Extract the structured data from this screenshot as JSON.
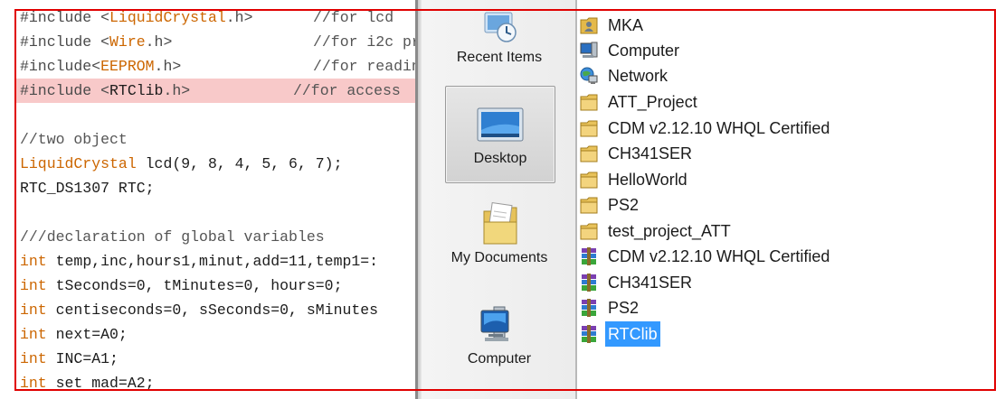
{
  "editor": {
    "lines": [
      {
        "type": "include",
        "prefix": "#include <",
        "lib": "LiquidCrystal",
        "suffix": ".h>",
        "comment": "//for lcd"
      },
      {
        "type": "include",
        "prefix": "#include <",
        "lib": "Wire",
        "suffix": ".h>",
        "comment": "//for i2c pr"
      },
      {
        "type": "include",
        "prefix": "#include<",
        "lib": "EEPROM",
        "suffix": ".h>",
        "comment": "//for reading"
      },
      {
        "type": "include",
        "prefix": "#include <",
        "lib": "RTClib",
        "suffix": ".h>",
        "comment": "//for access"
      },
      {
        "type": "blank"
      },
      {
        "type": "comment",
        "text": "//two object"
      },
      {
        "type": "decl",
        "kw": "LiquidCrystal",
        "rest": " lcd(9, 8, 4, 5, 6, 7);"
      },
      {
        "type": "plain",
        "text": "RTC_DS1307 RTC;"
      },
      {
        "type": "blank"
      },
      {
        "type": "comment",
        "text": "///declaration of global variables"
      },
      {
        "type": "decl",
        "kw": "int",
        "rest": " temp,inc,hours1,minut,add=11,temp1=:"
      },
      {
        "type": "decl",
        "kw": "int",
        "rest": " tSeconds=0, tMinutes=0, hours=0;"
      },
      {
        "type": "decl",
        "kw": "int",
        "rest": " centiseconds=0, sSeconds=0, sMinutes"
      },
      {
        "type": "decl",
        "kw": "int",
        "rest": " next=A0;"
      },
      {
        "type": "decl",
        "kw": "int",
        "rest": " INC=A1;"
      },
      {
        "type": "decl",
        "kw": "int",
        "rest": " set mad=A2;"
      }
    ]
  },
  "places": {
    "items": [
      {
        "label": "Recent Items",
        "icon": "recent-items-icon"
      },
      {
        "label": "Desktop",
        "icon": "desktop-icon",
        "selected": true
      },
      {
        "label": "My Documents",
        "icon": "my-documents-icon"
      },
      {
        "label": "Computer",
        "icon": "computer-icon"
      }
    ]
  },
  "files": {
    "items": [
      {
        "name": "MKA",
        "icon": "user-folder-icon"
      },
      {
        "name": "Computer",
        "icon": "computer-icon"
      },
      {
        "name": "Network",
        "icon": "network-icon"
      },
      {
        "name": "ATT_Project",
        "icon": "folder-icon"
      },
      {
        "name": "CDM v2.12.10 WHQL Certified",
        "icon": "folder-icon"
      },
      {
        "name": "CH341SER",
        "icon": "folder-icon"
      },
      {
        "name": "HelloWorld",
        "icon": "folder-icon"
      },
      {
        "name": "PS2",
        "icon": "folder-icon"
      },
      {
        "name": "test_project_ATT",
        "icon": "folder-icon"
      },
      {
        "name": "CDM v2.12.10 WHQL Certified",
        "icon": "archive-icon"
      },
      {
        "name": "CH341SER",
        "icon": "archive-icon"
      },
      {
        "name": "PS2",
        "icon": "archive-icon"
      },
      {
        "name": "RTClib",
        "icon": "archive-icon",
        "selected": true
      }
    ]
  },
  "colors": {
    "frame": "#e00000",
    "highlight_line": "#f8c9c9",
    "keyword": "#cc6600",
    "selection": "#3399ff"
  }
}
